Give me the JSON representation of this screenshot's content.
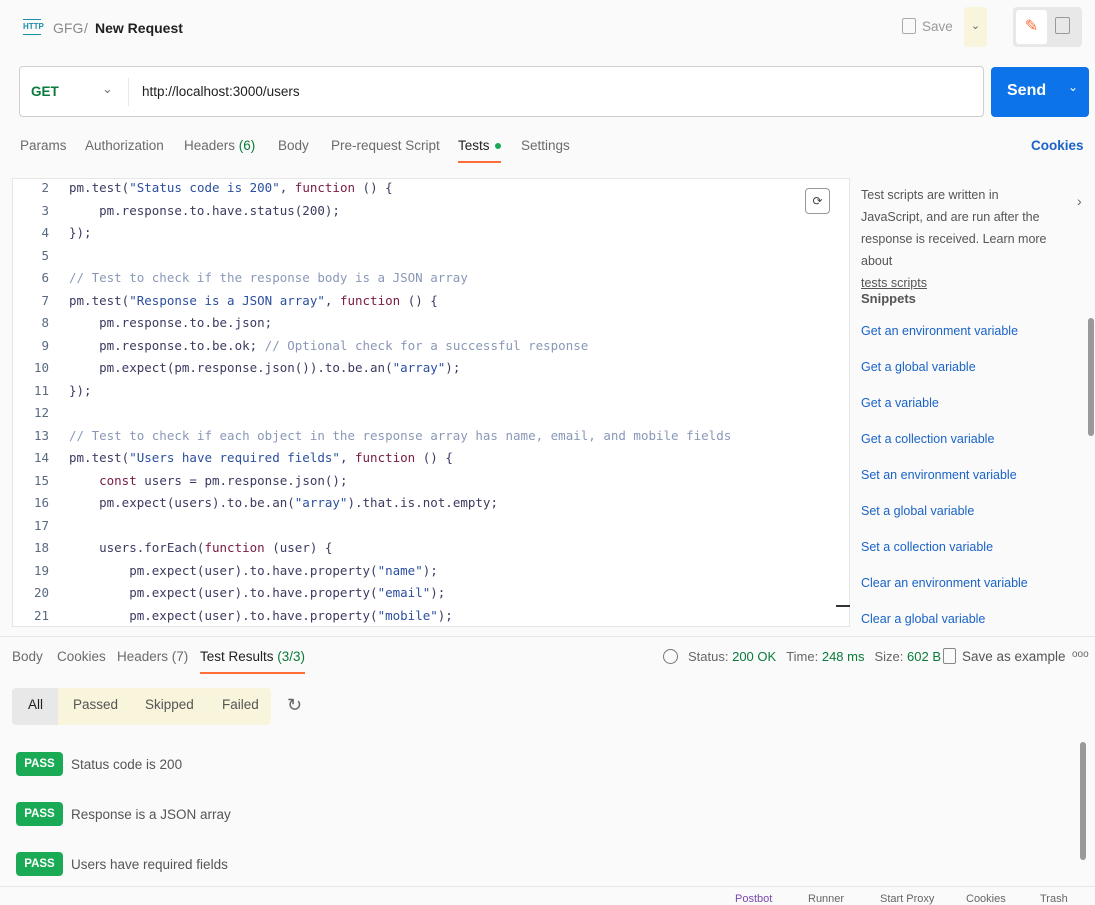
{
  "header": {
    "breadcrumb_parent": "GFG",
    "separator": "/",
    "title": "New Request",
    "save_label": "Save",
    "http_icon_text": "HTTP"
  },
  "request": {
    "method": "GET",
    "url": "http://localhost:3000/users",
    "send_label": "Send"
  },
  "tabs": [
    {
      "label": "Params"
    },
    {
      "label": "Authorization"
    },
    {
      "label": "Headers",
      "count": "(6)"
    },
    {
      "label": "Body"
    },
    {
      "label": "Pre-request Script"
    },
    {
      "label": "Tests"
    },
    {
      "label": "Settings"
    }
  ],
  "cookies_label": "Cookies",
  "code": [
    {
      "n": "2",
      "t": "pm.test(\"Status code is 200\", function () {"
    },
    {
      "n": "3",
      "t": "    pm.response.to.have.status(200);"
    },
    {
      "n": "4",
      "t": "});"
    },
    {
      "n": "5",
      "t": ""
    },
    {
      "n": "6",
      "t": "// Test to check if the response body is a JSON array"
    },
    {
      "n": "7",
      "t": "pm.test(\"Response is a JSON array\", function () {"
    },
    {
      "n": "8",
      "t": "    pm.response.to.be.json;"
    },
    {
      "n": "9",
      "t": "    pm.response.to.be.ok; // Optional check for a successful response"
    },
    {
      "n": "10",
      "t": "    pm.expect(pm.response.json()).to.be.an(\"array\");"
    },
    {
      "n": "11",
      "t": "});"
    },
    {
      "n": "12",
      "t": ""
    },
    {
      "n": "13",
      "t": "// Test to check if each object in the response array has name, email, and mobile fields"
    },
    {
      "n": "14",
      "t": "pm.test(\"Users have required fields\", function () {"
    },
    {
      "n": "15",
      "t": "    const users = pm.response.json();"
    },
    {
      "n": "16",
      "t": "    pm.expect(users).to.be.an(\"array\").that.is.not.empty;"
    },
    {
      "n": "17",
      "t": ""
    },
    {
      "n": "18",
      "t": "    users.forEach(function (user) {"
    },
    {
      "n": "19",
      "t": "        pm.expect(user).to.have.property(\"name\");"
    },
    {
      "n": "20",
      "t": "        pm.expect(user).to.have.property(\"email\");"
    },
    {
      "n": "21",
      "t": "        pm.expect(user).to.have.property(\"mobile\");"
    }
  ],
  "sidebar": {
    "description": "Test scripts are written in JavaScript, and are run after the response is received. Learn more about",
    "link": "tests scripts",
    "snippets_title": "Snippets",
    "snippets": [
      "Get an environment variable",
      "Get a global variable",
      "Get a variable",
      "Get a collection variable",
      "Set an environment variable",
      "Set a global variable",
      "Set a collection variable",
      "Clear an environment variable",
      "Clear a global variable"
    ]
  },
  "response": {
    "tabs": [
      "Body",
      "Cookies",
      "Headers (7)",
      "Test Results"
    ],
    "test_count": "(3/3)",
    "status_label": "Status:",
    "status": "200 OK",
    "time_label": "Time:",
    "time": "248 ms",
    "size_label": "Size:",
    "size": "602 B",
    "save_example": "Save as example",
    "filters": [
      "All",
      "Passed",
      "Skipped",
      "Failed"
    ],
    "results": [
      {
        "badge": "PASS",
        "name": "Status code is 200"
      },
      {
        "badge": "PASS",
        "name": "Response is a JSON array"
      },
      {
        "badge": "PASS",
        "name": "Users have required fields"
      }
    ]
  },
  "statusbar": [
    "Postbot",
    "Runner",
    "Start Proxy",
    "Cookies",
    "Trash"
  ],
  "colors": {
    "accent": "#ff6c37",
    "send": "#0c74e8",
    "pass": "#1aaa55",
    "link": "#1a63c7",
    "method": "#0b7a3b"
  }
}
